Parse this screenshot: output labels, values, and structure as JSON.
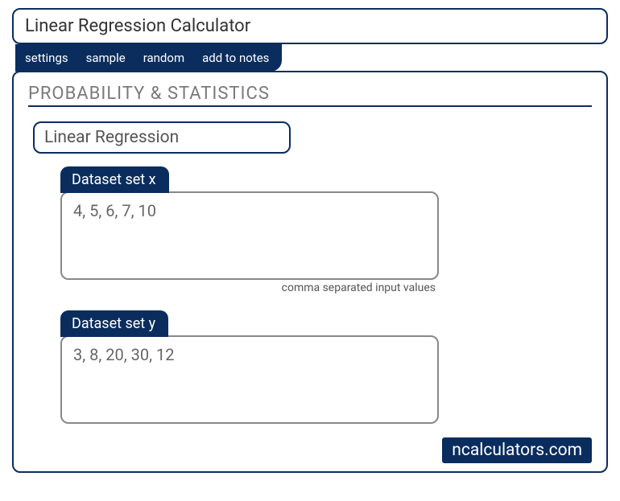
{
  "title": "Linear Regression Calculator",
  "toolbar": {
    "settings": "settings",
    "sample": "sample",
    "random": "random",
    "addToNotes": "add to notes"
  },
  "section": {
    "header": "PROBABILITY & STATISTICS",
    "subtitle": "Linear Regression"
  },
  "datasets": {
    "x": {
      "label": "Dataset set x",
      "value": "4, 5, 6, 7, 10",
      "helper": "comma separated input values"
    },
    "y": {
      "label": "Dataset set y",
      "value": "3, 8, 20, 30, 12"
    }
  },
  "watermark": "ncalculators.com"
}
